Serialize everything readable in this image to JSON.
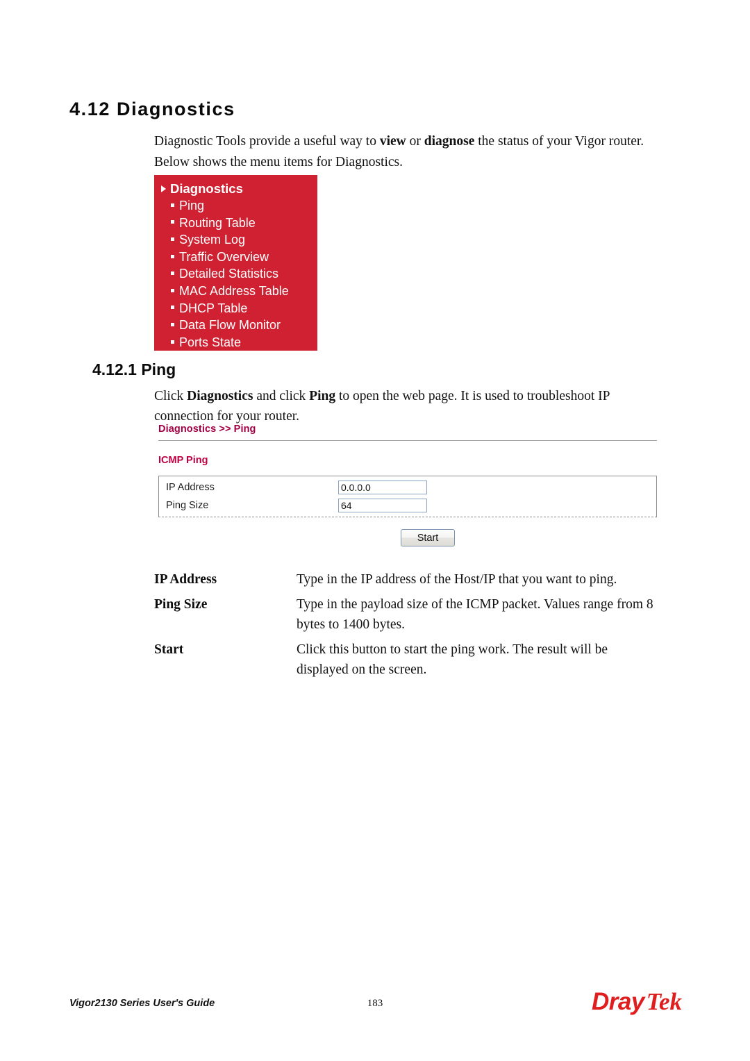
{
  "page": {
    "section_heading": "4.12 Diagnostics",
    "intro_paragraph_1_pre": "Diagnostic Tools provide a useful way to ",
    "intro_paragraph_1_bold_1": "view",
    "intro_paragraph_1_mid": " or ",
    "intro_paragraph_1_bold_2": "diagnose",
    "intro_paragraph_1_post": " the status of your Vigor router.",
    "intro_paragraph_2": "Below shows the menu items for Diagnostics.",
    "sub_heading": "4.12.1 Ping",
    "ping_paragraph_pre": "Click ",
    "ping_paragraph_bold_1": "Diagnostics",
    "ping_paragraph_mid": " and click ",
    "ping_paragraph_bold_2": "Ping",
    "ping_paragraph_post": " to open the web page. It is used to troubleshoot IP connection for your router."
  },
  "menu_panel": {
    "header": "Diagnostics",
    "header_icon": "triangle-right-icon",
    "bullet_icon": "square-bullet-icon",
    "background_color": "#cf2131",
    "text_color": "#ffffff",
    "items": [
      {
        "label": "Ping"
      },
      {
        "label": "Routing Table"
      },
      {
        "label": "System Log"
      },
      {
        "label": "Traffic Overview"
      },
      {
        "label": "Detailed Statistics"
      },
      {
        "label": "MAC Address Table"
      },
      {
        "label": "DHCP Table"
      },
      {
        "label": "Data Flow Monitor"
      },
      {
        "label": "Ports State"
      }
    ]
  },
  "ui_screenshot": {
    "breadcrumb": "Diagnostics >> Ping",
    "breadcrumb_color": "#a00043",
    "section_title": "ICMP Ping",
    "section_title_color": "#bf0040",
    "fields": [
      {
        "label": "IP Address",
        "value": "0.0.0.0"
      },
      {
        "label": "Ping Size",
        "value": "64"
      }
    ],
    "start_button_label": "Start"
  },
  "definitions": [
    {
      "term": "IP Address",
      "description": "Type in the IP address of the Host/IP that you want to ping."
    },
    {
      "term": "Ping Size",
      "description": "Type in the payload size of the ICMP packet. Values range from 8 bytes to 1400 bytes."
    },
    {
      "term": "Start",
      "description": "Click this button to start the ping work. The result will be displayed on the screen."
    }
  ],
  "footer": {
    "guide_title": "Vigor2130 Series User's Guide",
    "page_number": "183",
    "logo_part_1": "Dray",
    "logo_part_2": "Tek",
    "logo_color": "#df1f1f"
  }
}
